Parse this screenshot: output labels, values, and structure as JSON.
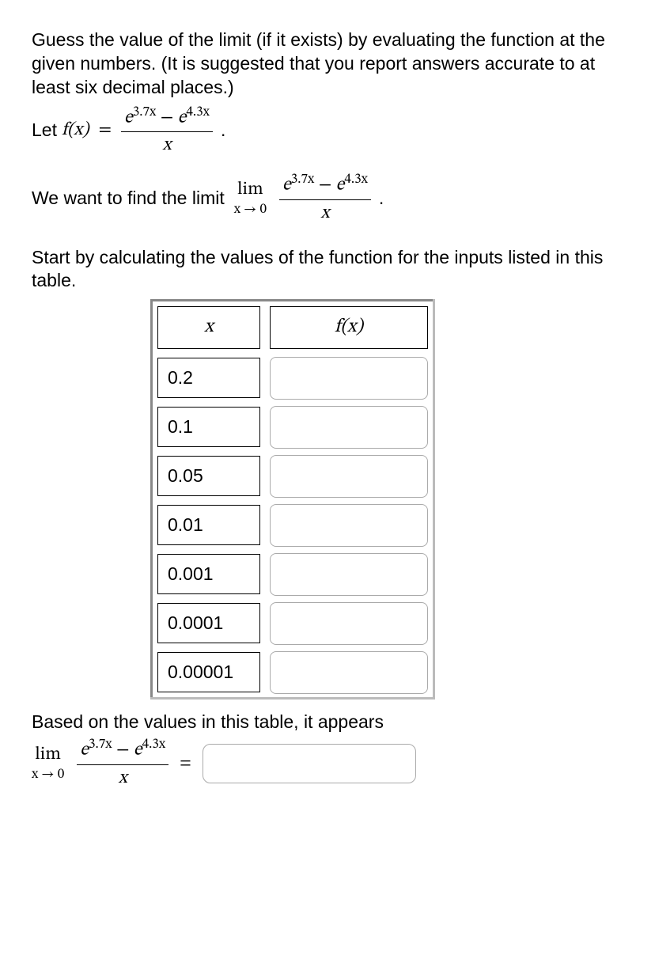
{
  "prompt_text": "Guess the value of the limit (if it exists) by evaluating the function at the given numbers. (It is suggested that you report answers accurate to at least six decimal places.)",
  "let_prefix": "Let ",
  "fx": "f(x)",
  "equals": "=",
  "numerator_pieces": {
    "e1_exp": "3.7x",
    "minus": " − ",
    "e2_exp": "4.3x"
  },
  "denominator": "x",
  "period": ".",
  "want_text": "We want to find the limit ",
  "lim_top": "lim",
  "lim_bot": "x → 0",
  "start_text": "Start by calculating the values of the function for the inputs listed in this table.",
  "table": {
    "col_x": "x",
    "col_fx": "f(x)",
    "rows": [
      {
        "x": "0.2"
      },
      {
        "x": "0.1"
      },
      {
        "x": "0.05"
      },
      {
        "x": "0.01"
      },
      {
        "x": "0.001"
      },
      {
        "x": "0.0001"
      },
      {
        "x": "0.00001"
      }
    ]
  },
  "based_text": "Based on the values in this table, it appears"
}
